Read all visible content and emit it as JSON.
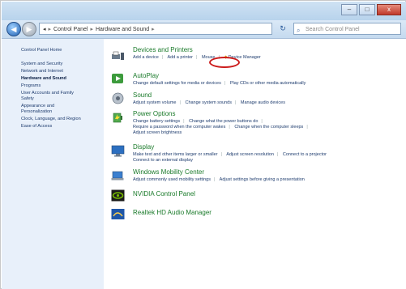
{
  "window": {
    "min": "–",
    "max": "□",
    "close": "x"
  },
  "nav": {
    "back": "◀",
    "forward": "▶"
  },
  "address": {
    "root_arrow": "◂",
    "crumbs": [
      "Control Panel",
      "Hardware and Sound"
    ],
    "chevron": "▸"
  },
  "search": {
    "placeholder": "Search Control Panel",
    "icon": "search-icon"
  },
  "refresh": "↻",
  "leftpane": {
    "items": [
      "Control Panel Home",
      "System and Security",
      "Network and Internet",
      "Hardware and Sound",
      "Programs",
      "User Accounts and Family",
      "Safety",
      "Appearance and",
      "Personalization",
      "Clock, Language, and Region",
      "Ease of Access"
    ],
    "active_index": 3
  },
  "categories": [
    {
      "title": "Devices and Printers",
      "links": [
        "Add a device",
        "Add a printer",
        "Mouse",
        "Device Manager"
      ],
      "icon": "printer-icon"
    },
    {
      "title": "AutoPlay",
      "links": [
        "Change default settings for media or devices",
        "Play CDs or other media automatically"
      ],
      "icon": "autoplay-icon"
    },
    {
      "title": "Sound",
      "links": [
        "Adjust system volume",
        "Change system sounds",
        "Manage audio devices"
      ],
      "icon": "speaker-icon"
    },
    {
      "title": "Power Options",
      "links": [
        "Change battery settings",
        "Change what the power buttons do",
        "Require a password when the computer wakes",
        "Change when the computer sleeps",
        "Adjust screen brightness"
      ],
      "icon": "battery-icon"
    },
    {
      "title": "Display",
      "links": [
        "Make text and other items larger or smaller",
        "Adjust screen resolution",
        "Connect to a projector",
        "Connect to an external display"
      ],
      "icon": "monitor-icon"
    },
    {
      "title": "Windows Mobility Center",
      "links": [
        "Adjust commonly used mobility settings",
        "Adjust settings before giving a presentation"
      ],
      "icon": "mobility-icon"
    },
    {
      "title": "NVIDIA Control Panel",
      "links": [],
      "icon": "nvidia-icon"
    },
    {
      "title": "Realtek HD Audio Manager",
      "links": [],
      "icon": "realtek-icon"
    }
  ],
  "colors": {
    "category_title": "#1a7a2a",
    "link": "#1e3c6e",
    "highlight": "#cc1c1c",
    "leftpane_bg": "#e8f0fa"
  }
}
